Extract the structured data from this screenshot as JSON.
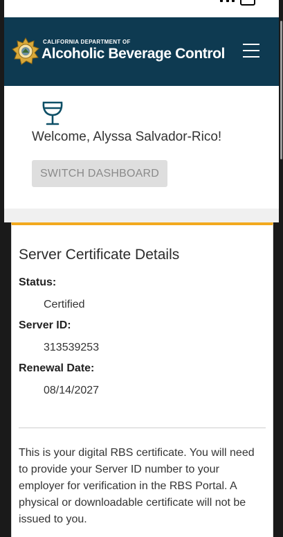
{
  "header": {
    "logo_small": "CALIFORNIA DEPARTMENT OF",
    "logo_big": "Alcoholic Beverage Control",
    "menu_icon": "hamburger-menu-icon"
  },
  "welcome": {
    "icon": "wine-glass-icon",
    "greeting": "Welcome, Alyssa Salvador-Rico!",
    "switch_button_label": "SWITCH DASHBOARD"
  },
  "certificate": {
    "title": "Server Certificate Details",
    "fields": [
      {
        "label": "Status:",
        "value": "Certified"
      },
      {
        "label": "Server ID:",
        "value": "313539253"
      },
      {
        "label": "Renewal Date:",
        "value": "08/14/2027"
      }
    ],
    "info": "This is your digital RBS certificate. You will need to provide your Server ID number to your employer for verification in the RBS Portal. A physical or downloadable certificate will not be issued to you."
  },
  "colors": {
    "header_bg": "#0e3a51",
    "card_accent": "#f2a91e"
  }
}
